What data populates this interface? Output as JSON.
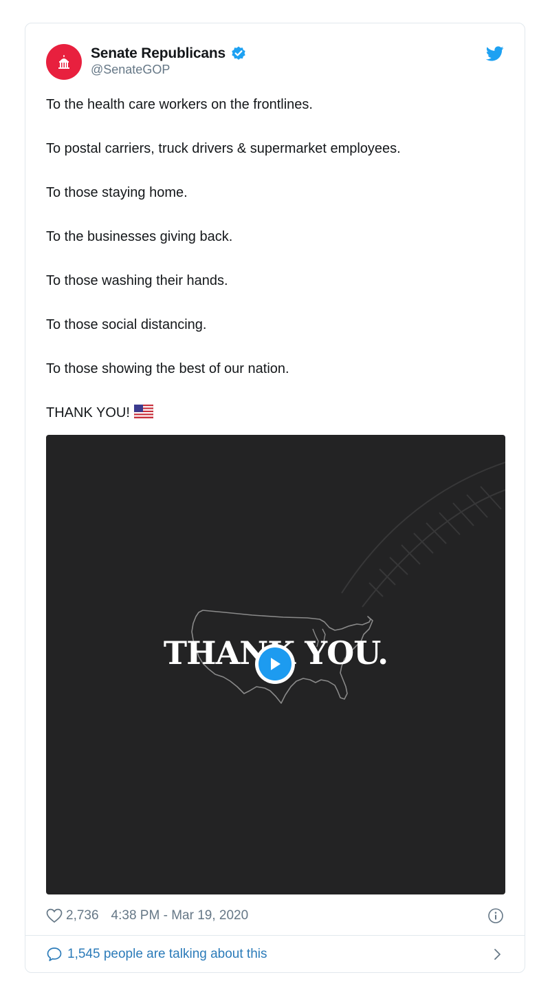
{
  "account": {
    "display_name": "Senate Republicans",
    "handle": "@SenateGOP",
    "avatar_color": "#e8203e",
    "verified": true
  },
  "tweet": {
    "lines": [
      "To the health care workers on the frontlines.",
      "To postal carriers, truck drivers & supermarket employees.",
      "To those staying home.",
      "To the businesses giving back.",
      "To those washing their hands.",
      "To those social distancing.",
      "To those showing the best of our nation.",
      "THANK YOU!"
    ],
    "emoji": "us-flag"
  },
  "media": {
    "overlay_text": "THANK YOU.",
    "background_color": "#232324"
  },
  "footer": {
    "like_count": "2,736",
    "timestamp": "4:38 PM - Mar 19, 2020",
    "talking_text": "1,545 people are talking about this"
  },
  "colors": {
    "link_blue": "#2b7bb9",
    "twitter_blue": "#1da1f2",
    "muted_gray": "#657786"
  },
  "icons": [
    "capitol-icon",
    "verified-badge-icon",
    "twitter-bird-icon",
    "play-icon",
    "heart-icon",
    "info-icon",
    "speech-bubble-icon",
    "chevron-right-icon"
  ]
}
